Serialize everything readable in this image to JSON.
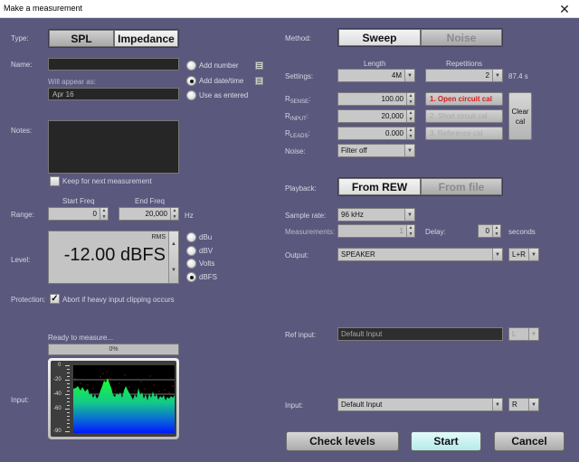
{
  "window": {
    "title": "Make a measurement",
    "close_icon": "close-icon"
  },
  "type": {
    "label": "Type:",
    "options": [
      {
        "label": "SPL",
        "active": false
      },
      {
        "label": "Impedance",
        "active": true
      }
    ]
  },
  "name": {
    "label": "Name:",
    "value": "",
    "will_appear_label": "Will appear as:",
    "will_appear_value": "Apr 16",
    "naming_options": [
      {
        "label": "Add number",
        "checked": false
      },
      {
        "label": "Add date/time",
        "checked": true
      },
      {
        "label": "Use as entered",
        "checked": false
      }
    ]
  },
  "notes": {
    "label": "Notes:",
    "value": "",
    "keep_label": "Keep for next measurement",
    "keep_checked": false
  },
  "range": {
    "label": "Range:",
    "start_label": "Start Freq",
    "start_value": "0",
    "end_label": "End Freq",
    "end_value": "20,000",
    "unit": "Hz"
  },
  "level": {
    "label": "Level:",
    "mode": "RMS",
    "value": "-12.00 dBFS",
    "units": [
      {
        "label": "dBu",
        "checked": false
      },
      {
        "label": "dBV",
        "checked": false
      },
      {
        "label": "Volts",
        "checked": false
      },
      {
        "label": "dBFS",
        "checked": true
      }
    ]
  },
  "protection": {
    "label": "Protection:",
    "checkbox_label": "Abort if heavy input clipping occurs",
    "checked": true
  },
  "status": {
    "text": "Ready to measure...",
    "progress_text": "0%",
    "progress": 0
  },
  "input_meter": {
    "label": "Input:",
    "scale_labels": [
      "0",
      "-20",
      "-40",
      "-60",
      "-90"
    ]
  },
  "method": {
    "label": "Method:",
    "options": [
      {
        "label": "Sweep",
        "active": true
      },
      {
        "label": "Noise",
        "active": false,
        "disabled": true
      }
    ]
  },
  "settings": {
    "label": "Settings:",
    "length_label": "Length",
    "length_value": "4M",
    "repetitions_label": "Repetitions",
    "repetitions_value": "2",
    "duration": "87.4 s"
  },
  "impedance": {
    "rsense_label": "R",
    "rsense_sub": "SENSE",
    "rsense_value": "100.00",
    "rinput_label": "R",
    "rinput_sub": "INPUT",
    "rinput_value": "20,000",
    "rleads_label": "R",
    "rleads_sub": "LEADS",
    "rleads_value": "0.000",
    "noise_label": "Noise:",
    "noise_value": "Filter off",
    "cal_buttons": [
      {
        "label": "1. Open circuit cal",
        "enabled": true
      },
      {
        "label": "2. Short circuit cal",
        "enabled": false
      },
      {
        "label": "3. Reference cal",
        "enabled": false
      }
    ],
    "clear_cal_line1": "Clear",
    "clear_cal_line2": "cal"
  },
  "playback": {
    "label": "Playback:",
    "options": [
      {
        "label": "From REW",
        "active": true
      },
      {
        "label": "From file",
        "active": false,
        "disabled": true
      }
    ]
  },
  "sample_rate": {
    "label": "Sample rate:",
    "value": "96 kHz"
  },
  "measurements": {
    "label": "Measurements:",
    "value": "1"
  },
  "delay": {
    "label": "Delay:",
    "value": "0",
    "unit": "seconds"
  },
  "output": {
    "label": "Output:",
    "device": "SPEAKER",
    "channel": "L+R"
  },
  "ref_input": {
    "label": "Ref input:",
    "device": "Default Input",
    "channel": "L"
  },
  "input": {
    "label": "Input:",
    "device": "Default Input",
    "channel": "R"
  },
  "actions": {
    "check_levels": "Check levels",
    "start": "Start",
    "cancel": "Cancel"
  }
}
